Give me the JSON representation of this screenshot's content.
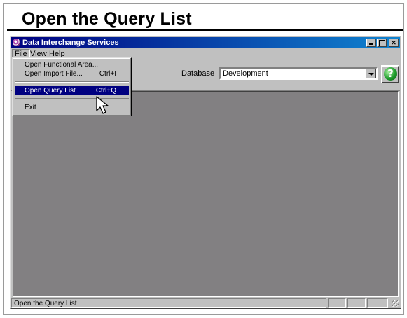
{
  "slide": {
    "title": "Open the Query List"
  },
  "window": {
    "title": "Data Interchange Services",
    "controls": {
      "minimize": "minimize",
      "maximize": "maximize",
      "close": "✕"
    }
  },
  "menubar": {
    "file": "File",
    "view": "View",
    "help": "Help"
  },
  "file_menu": {
    "items": [
      {
        "label": "Open Functional Area...",
        "shortcut": ""
      },
      {
        "label": "Open Import File...",
        "shortcut": "Ctrl+I"
      },
      {
        "label": "Open Query List",
        "shortcut": "Ctrl+Q",
        "highlighted": true
      },
      {
        "label": "Exit",
        "shortcut": ""
      }
    ]
  },
  "toolbar": {
    "database_label": "Database",
    "database_value": "Development",
    "help_glyph": "?"
  },
  "statusbar": {
    "text": "Open the Query List"
  },
  "icons": [
    "app-globe-icon",
    "help-question-icon",
    "dropdown-arrow-icon",
    "mouse-pointer-icon",
    "size-grip-icon"
  ],
  "colors": {
    "title_bar": "#000080",
    "workspace": "#828082",
    "chrome": "#c0c0c0",
    "menu_highlight": "#000080",
    "help_icon": "#1e9c2c"
  }
}
